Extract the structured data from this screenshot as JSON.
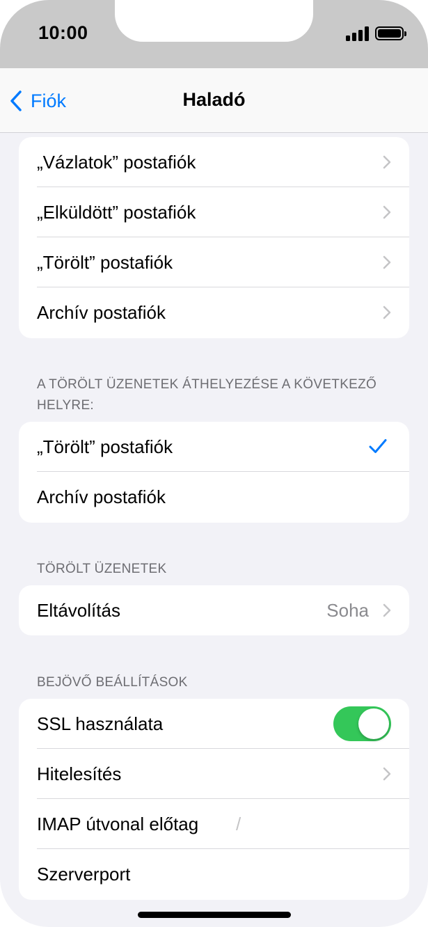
{
  "status_bar": {
    "time": "10:00"
  },
  "nav": {
    "back_label": "Fiók",
    "title": "Haladó"
  },
  "mailbox_group": {
    "items": [
      {
        "label": "„Vázlatok” postafiók"
      },
      {
        "label": "„Elküldött” postafiók"
      },
      {
        "label": "„Törölt” postafiók"
      },
      {
        "label": "Archív postafiók"
      }
    ]
  },
  "move_deleted": {
    "header": "A TÖRÖLT ÜZENETEK ÁTHELYEZÉSE A KÖVETKEZŐ HELYRE:",
    "options": [
      {
        "label": "„Törölt” postafiók",
        "selected": true
      },
      {
        "label": "Archív postafiók",
        "selected": false
      }
    ]
  },
  "deleted_messages": {
    "header": "TÖRÖLT ÜZENETEK",
    "remove_label": "Eltávolítás",
    "remove_value": "Soha"
  },
  "incoming": {
    "header": "BEJÖVŐ BEÁLLÍTÁSOK",
    "ssl_label": "SSL használata",
    "ssl_enabled": true,
    "auth_label": "Hitelesítés",
    "imap_prefix_label": "IMAP útvonal előtag",
    "imap_prefix_value": "/",
    "server_port_label": "Szerverport"
  },
  "colors": {
    "accent": "#007aff",
    "toggle_on": "#34c759",
    "background": "#f2f2f7"
  }
}
